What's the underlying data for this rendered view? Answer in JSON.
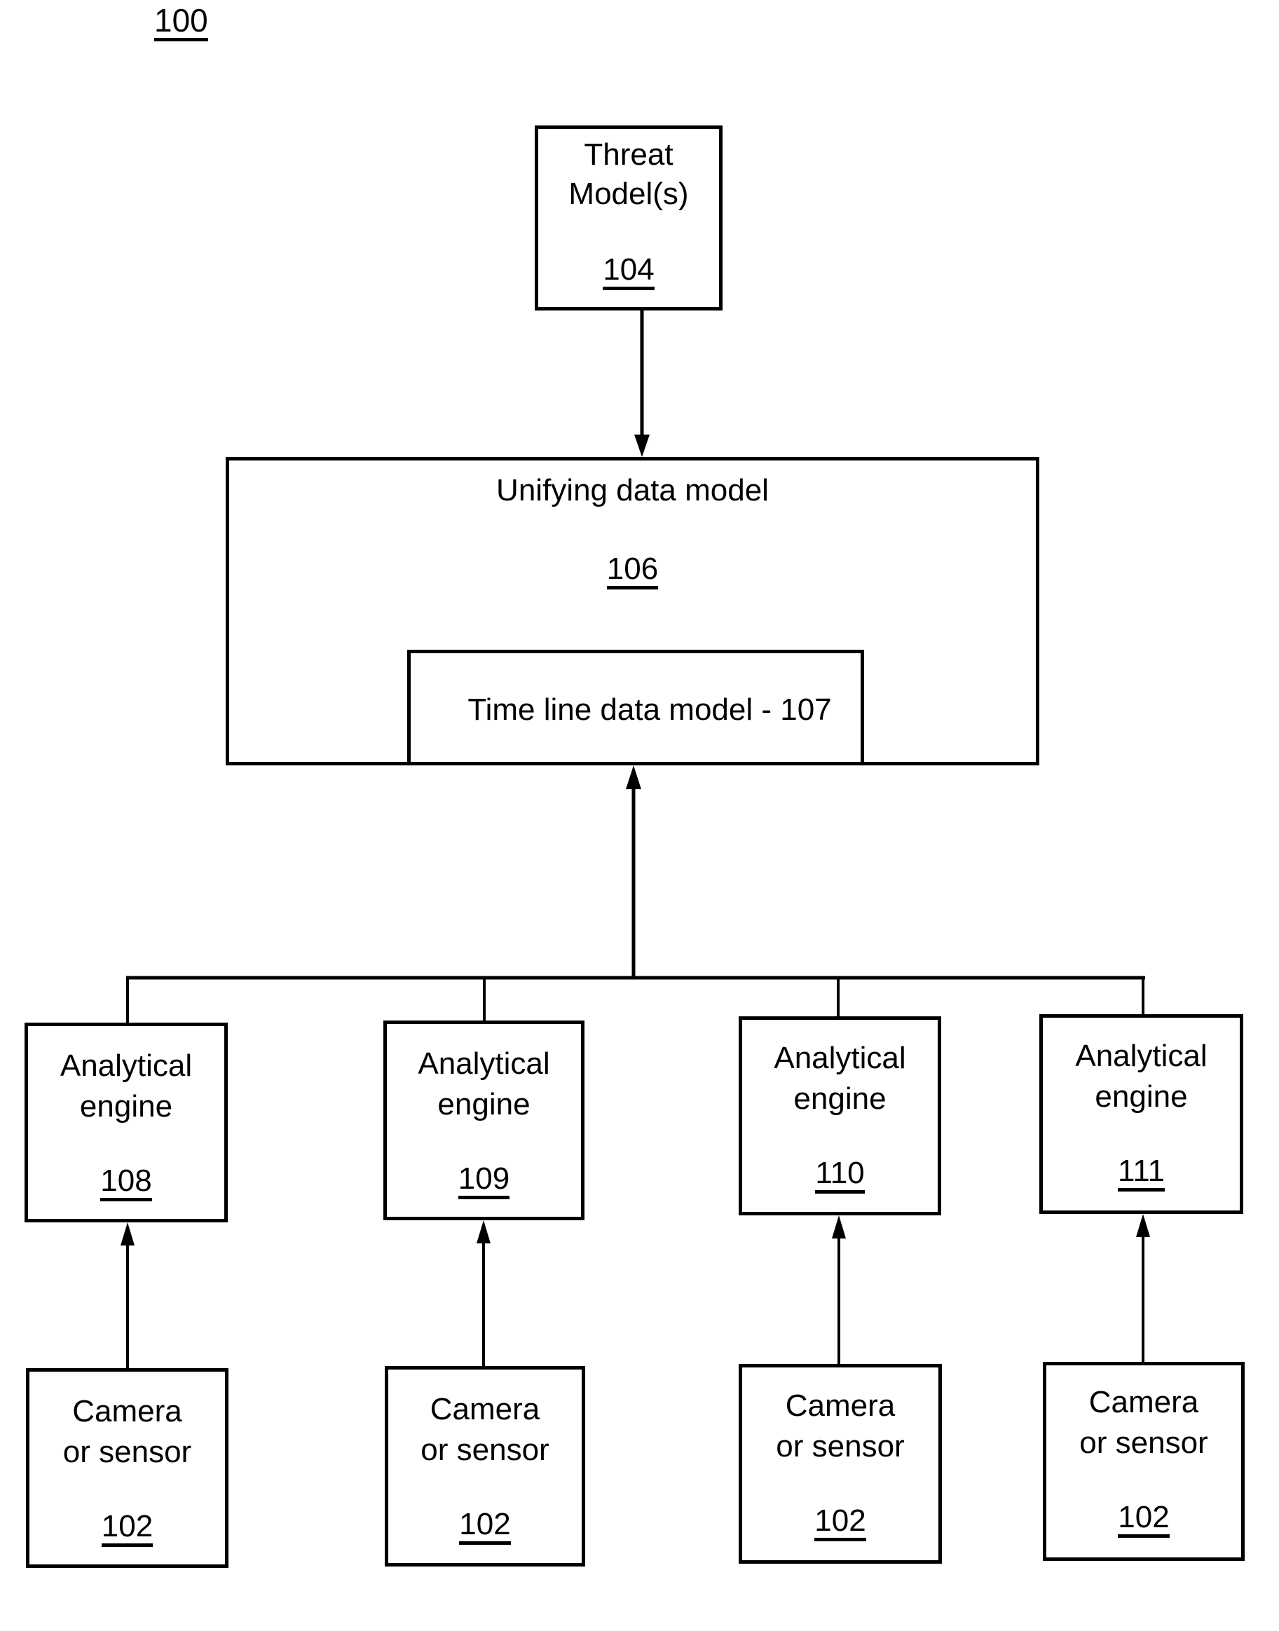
{
  "figure": {
    "number": "100"
  },
  "threat_model": {
    "line1": "Threat",
    "line2": "Model(s)",
    "ref": "104"
  },
  "unifying_model": {
    "title": "Unifying data model",
    "ref": "106"
  },
  "timeline_model": {
    "title": "Time line data model - 107"
  },
  "engines": [
    {
      "line1": "Analytical",
      "line2": "engine",
      "ref": "108"
    },
    {
      "line1": "Analytical",
      "line2": "engine",
      "ref": "109"
    },
    {
      "line1": "Analytical",
      "line2": "engine",
      "ref": "110"
    },
    {
      "line1": "Analytical",
      "line2": "engine",
      "ref": "111"
    }
  ],
  "sensors": [
    {
      "line1": "Camera",
      "line2": "or sensor",
      "ref": "102"
    },
    {
      "line1": "Camera",
      "line2": "or sensor",
      "ref": "102"
    },
    {
      "line1": "Camera",
      "line2": "or sensor",
      "ref": "102"
    },
    {
      "line1": "Camera",
      "line2": "or sensor",
      "ref": "102"
    }
  ],
  "connections": [
    {
      "from": "104",
      "to": "106",
      "type": "arrow"
    },
    {
      "from": "108",
      "to": "107",
      "type": "bus-arrow"
    },
    {
      "from": "109",
      "to": "107",
      "type": "bus-arrow"
    },
    {
      "from": "110",
      "to": "107",
      "type": "bus-arrow"
    },
    {
      "from": "111",
      "to": "107",
      "type": "bus-arrow"
    },
    {
      "from": "102",
      "to": "108",
      "type": "arrow"
    },
    {
      "from": "102",
      "to": "109",
      "type": "arrow"
    },
    {
      "from": "102",
      "to": "110",
      "type": "arrow"
    },
    {
      "from": "102",
      "to": "111",
      "type": "arrow"
    }
  ]
}
